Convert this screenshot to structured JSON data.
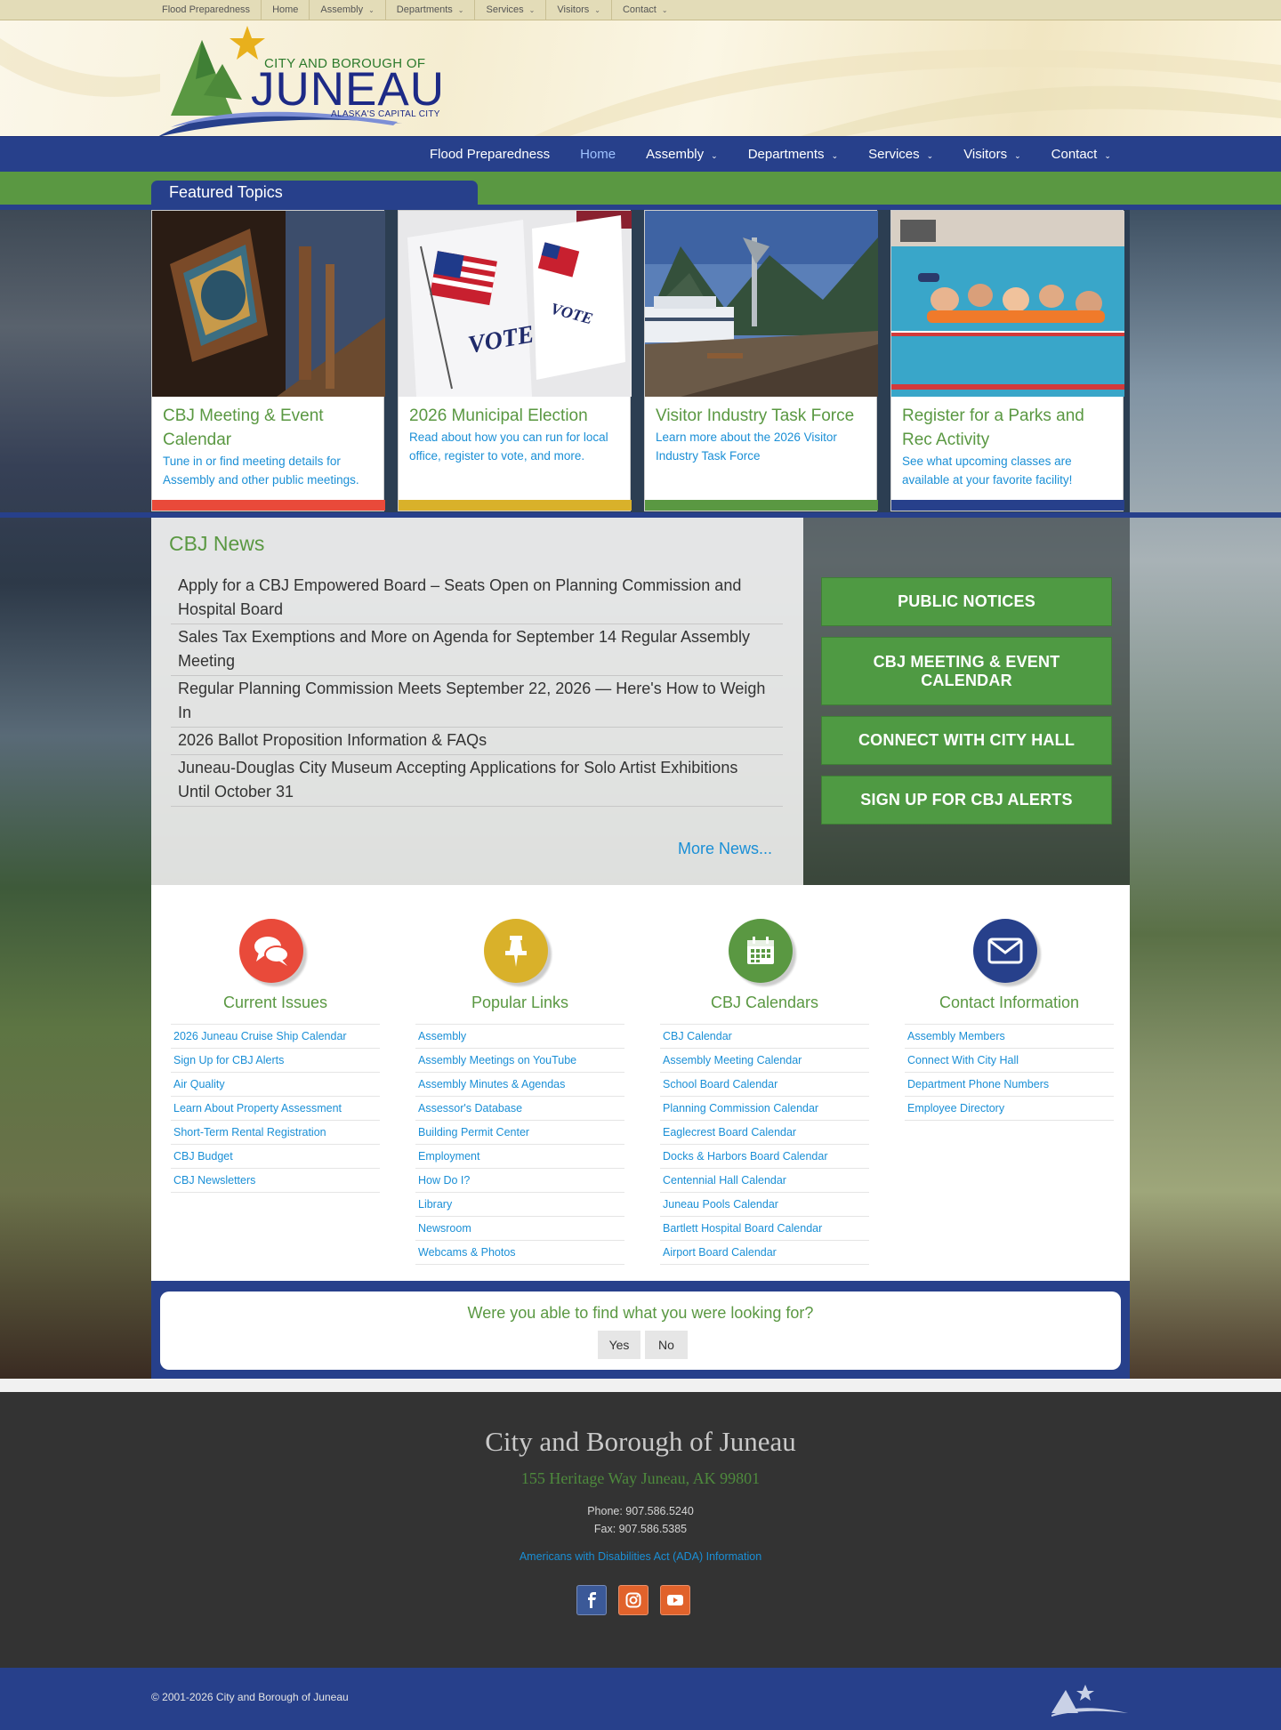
{
  "utility_nav": {
    "items": [
      {
        "label": "Flood Preparedness",
        "dropdown": false
      },
      {
        "label": "Home",
        "dropdown": false
      },
      {
        "label": "Assembly",
        "dropdown": true
      },
      {
        "label": "Departments",
        "dropdown": true
      },
      {
        "label": "Services",
        "dropdown": true
      },
      {
        "label": "Visitors",
        "dropdown": true
      },
      {
        "label": "Contact",
        "dropdown": true
      }
    ]
  },
  "logo": {
    "line1": "CITY AND BOROUGH OF",
    "line2": "JUNEAU",
    "line3": "ALASKA'S CAPITAL CITY"
  },
  "main_nav": {
    "active": "Home",
    "items": [
      {
        "label": "Flood Preparedness",
        "dropdown": false
      },
      {
        "label": "Home",
        "dropdown": false
      },
      {
        "label": "Assembly",
        "dropdown": true
      },
      {
        "label": "Departments",
        "dropdown": true
      },
      {
        "label": "Services",
        "dropdown": true
      },
      {
        "label": "Visitors",
        "dropdown": true
      },
      {
        "label": "Contact",
        "dropdown": true
      }
    ]
  },
  "featured": {
    "heading": "Featured Topics",
    "cards": [
      {
        "title": "CBJ Meeting & Event Calendar",
        "desc": "Tune in or find meeting details for Assembly and other public meetings.",
        "color": "#e94a3a",
        "image": "city-hall-sign"
      },
      {
        "title": "2026 Municipal Election",
        "desc": "Read about how you can run for local office, register to vote, and more.",
        "color": "#d9b12a",
        "image": "vote-booth"
      },
      {
        "title": "Visitor Industry Task Force",
        "desc": "Learn more about the 2026 Visitor Industry Task Force",
        "color": "#5a9842",
        "image": "cruise-ship-dock"
      },
      {
        "title": "Register for a Parks and Rec Activity",
        "desc": "See what upcoming classes are available at your favorite facility!",
        "color": "#27408b",
        "image": "swimming-pool"
      }
    ]
  },
  "news": {
    "heading": "CBJ News",
    "items": [
      "Apply for a CBJ Empowered Board – Seats Open on Planning Commission and Hospital Board",
      "Sales Tax Exemptions and More on Agenda for September 14 Regular Assembly Meeting",
      "Regular Planning Commission Meets September 22, 2026 — Here's How to Weigh In",
      "2026 Ballot Proposition Information & FAQs",
      "Juneau-Douglas City Museum Accepting Applications for Solo Artist Exhibitions Until October 31"
    ],
    "more": "More News..."
  },
  "quick_buttons": [
    "PUBLIC NOTICES",
    "CBJ MEETING & EVENT CALENDAR",
    "CONNECT WITH CITY HALL",
    "SIGN UP FOR CBJ ALERTS"
  ],
  "link_columns": [
    {
      "title": "Current Issues",
      "icon": "speech-bubbles-icon",
      "color": "#e94a3a",
      "links": [
        "2026 Juneau Cruise Ship Calendar",
        "Sign Up for CBJ Alerts",
        "Air Quality",
        "Learn About Property Assessment",
        "Short-Term Rental Registration",
        "CBJ Budget",
        "CBJ Newsletters"
      ]
    },
    {
      "title": "Popular Links",
      "icon": "pushpin-icon",
      "color": "#d9b12a",
      "links": [
        "Assembly",
        "Assembly Meetings on YouTube",
        "Assembly Minutes & Agendas",
        "Assessor's Database",
        "Building Permit Center",
        "Employment",
        "How Do I?",
        "Library",
        "Newsroom",
        "Webcams & Photos"
      ]
    },
    {
      "title": "CBJ Calendars",
      "icon": "calendar-icon",
      "color": "#5a9842",
      "links": [
        "CBJ Calendar",
        "Assembly Meeting Calendar",
        "School Board Calendar",
        "Planning Commission Calendar",
        "Eaglecrest Board Calendar",
        "Docks & Harbors Board Calendar",
        "Centennial Hall Calendar",
        "Juneau Pools Calendar",
        "Bartlett Hospital Board Calendar",
        "Airport Board Calendar"
      ]
    },
    {
      "title": "Contact Information",
      "icon": "envelope-icon",
      "color": "#27408b",
      "links": [
        "Assembly Members",
        "Connect With City Hall",
        "Department Phone Numbers",
        "Employee Directory"
      ]
    }
  ],
  "feedback": {
    "question": "Were you able to find what you were looking for?",
    "yes": "Yes",
    "no": "No"
  },
  "footer": {
    "org": "City and Borough of Juneau",
    "address": "155 Heritage Way Juneau, AK 99801",
    "phone": "Phone: 907.586.5240",
    "fax": "Fax: 907.586.5385",
    "ada": "Americans with Disabilities Act (ADA) Information",
    "social": [
      {
        "name": "facebook-icon",
        "color": "#3b5998"
      },
      {
        "name": "instagram-icon",
        "color": "#e1622b"
      },
      {
        "name": "youtube-icon",
        "color": "#e1622b"
      }
    ],
    "copyright": "© 2001-2026 City and Borough of Juneau"
  }
}
